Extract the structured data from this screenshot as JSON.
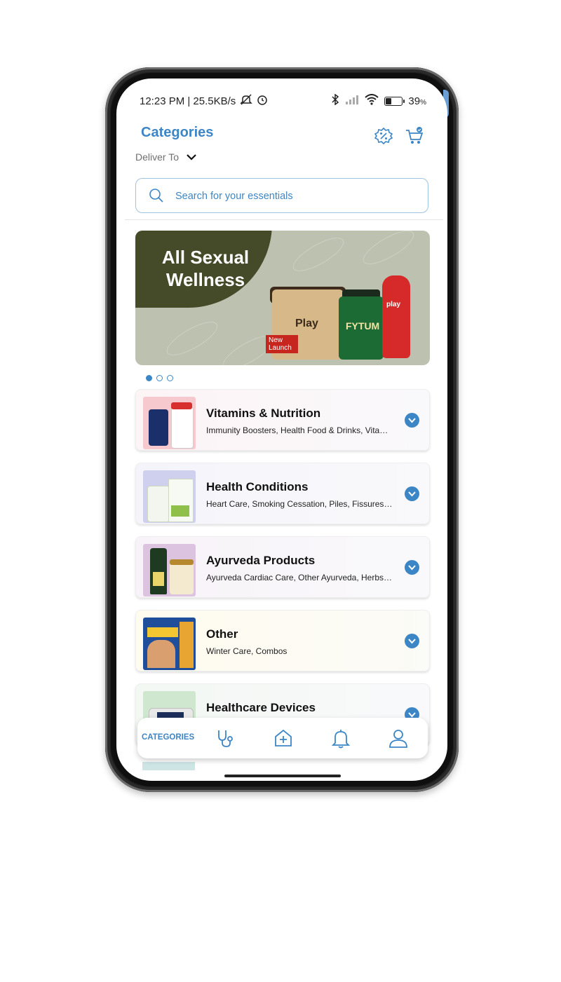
{
  "status_bar": {
    "time_info": "12:23 PM | 25.5KB/s",
    "battery": "39",
    "battery_unit": "%",
    "battery_level": 0.39
  },
  "header": {
    "title": "Categories",
    "deliver_label": "Deliver To",
    "offers_icon": "percent-badge-icon",
    "cart_icon": "cart-icon"
  },
  "search": {
    "placeholder": "Search for your essentials"
  },
  "banner": {
    "title_line1": "All Sexual",
    "title_line2": "Wellness",
    "jar_label": "Play",
    "launch_line1": "New",
    "launch_line2": "Launch",
    "bottle_label": "FYTUM",
    "tube_label": "play",
    "slide_count": 3,
    "active_slide": 1
  },
  "categories": [
    {
      "title": "Vitamins & Nutrition",
      "subtitle": "Immunity Boosters, Health Food & Drinks, Vitamins & Supplements"
    },
    {
      "title": "Health Conditions",
      "subtitle": "Heart Care, Smoking Cessation, Piles, Fissures & Fistula"
    },
    {
      "title": "Ayurveda Products",
      "subtitle": "Ayurveda Cardiac Care, Other Ayurveda, Herbs, Ayurvedic Oils"
    },
    {
      "title": "Other",
      "subtitle": "Winter Care, Combos"
    },
    {
      "title": "Healthcare Devices",
      "subtitle": ""
    }
  ],
  "bottom_nav": {
    "active_label": "CATEGORIES",
    "icons": [
      "stethoscope-icon",
      "medical-home-icon",
      "bell-icon",
      "profile-icon"
    ]
  },
  "colors": {
    "accent": "#3d86c6",
    "banner_bg": "#bdc2b0",
    "banner_blob": "#454a29"
  }
}
